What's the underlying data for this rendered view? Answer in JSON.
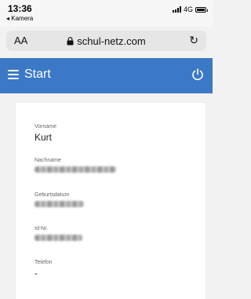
{
  "status_bar": {
    "time": "13:36",
    "back_app": "◂ Kamera",
    "network": "4G"
  },
  "browser": {
    "aa_label": "AA",
    "domain": "schul-netz.com"
  },
  "header": {
    "title": "Start",
    "color": "#3b79c6"
  },
  "profile": {
    "fields": [
      {
        "label": "Vorname",
        "value": "Kurt"
      },
      {
        "label": "Nachname",
        "value": ""
      },
      {
        "label": "Geburtsdatum",
        "value": ""
      },
      {
        "label": "Id-Nr.",
        "value": ""
      },
      {
        "label": "Telefon",
        "value": "-"
      }
    ]
  }
}
